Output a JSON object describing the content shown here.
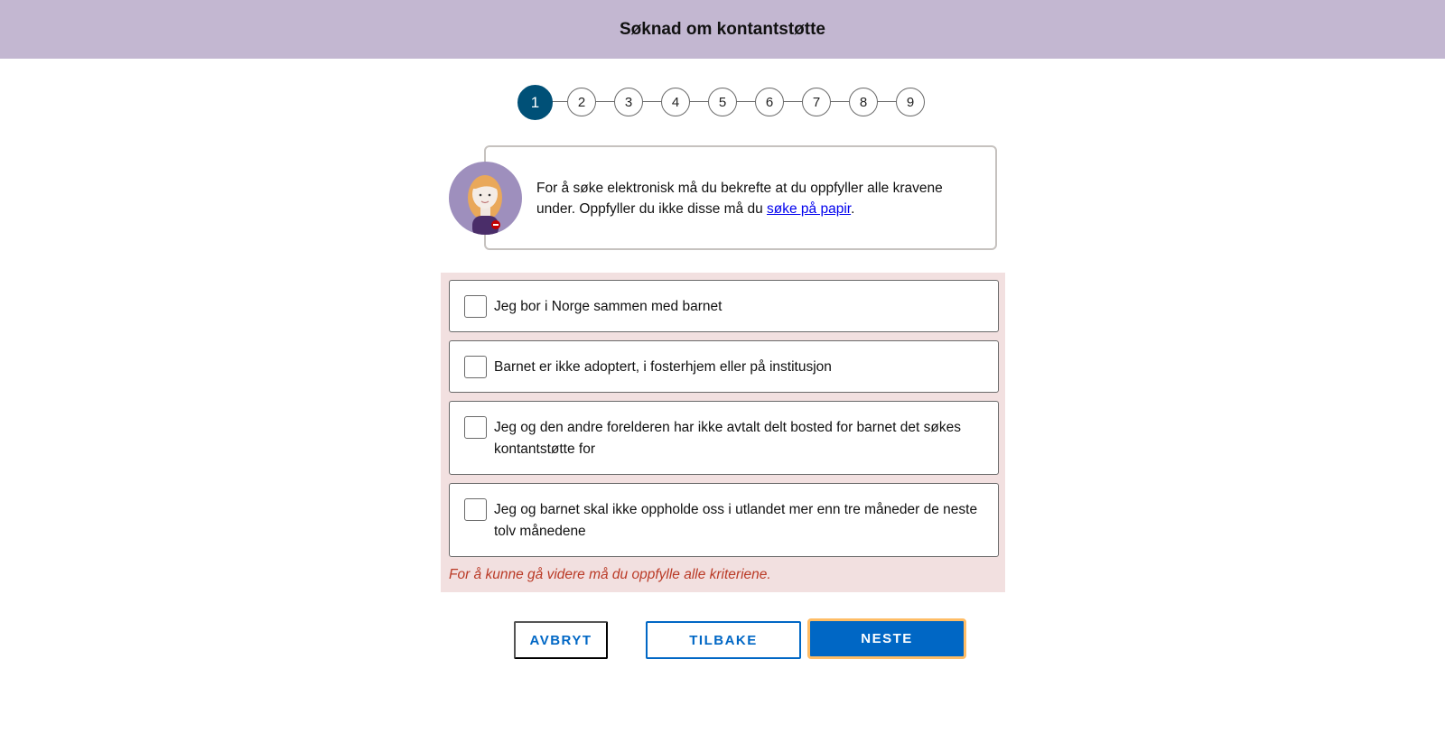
{
  "header": {
    "title": "Søknad om kontantstøtte"
  },
  "stepper": {
    "current": 1,
    "steps": [
      "1",
      "2",
      "3",
      "4",
      "5",
      "6",
      "7",
      "8",
      "9"
    ]
  },
  "veileder": {
    "text_before": "For å søke elektronisk må du bekrefte at du oppfyller alle kravene under. Oppfyller du ikke disse må du ",
    "link_text": "søke på papir",
    "text_after": "."
  },
  "criteria": {
    "items": [
      {
        "label": "Jeg bor i Norge sammen med barnet",
        "checked": false
      },
      {
        "label": "Barnet er ikke adoptert, i fosterhjem eller på institusjon",
        "checked": false
      },
      {
        "label": "Jeg og den andre forelderen har ikke avtalt delt bosted for barnet det søkes kontantstøtte for",
        "checked": false
      },
      {
        "label": "Jeg og barnet skal ikke oppholde oss i utlandet mer enn tre måneder de neste tolv månedene",
        "checked": false
      }
    ],
    "error": "For å kunne gå videre må du oppfylle alle kriteriene."
  },
  "buttons": {
    "cancel": "AVBRYT",
    "back": "TILBAKE",
    "next": "NESTE"
  },
  "colors": {
    "header_bg": "#c3b7d1",
    "primary": "#0067c5",
    "step_active": "#005077",
    "error_bg": "#f2e0e0",
    "error_text": "#ba3a26",
    "focus": "#ffbd66"
  }
}
